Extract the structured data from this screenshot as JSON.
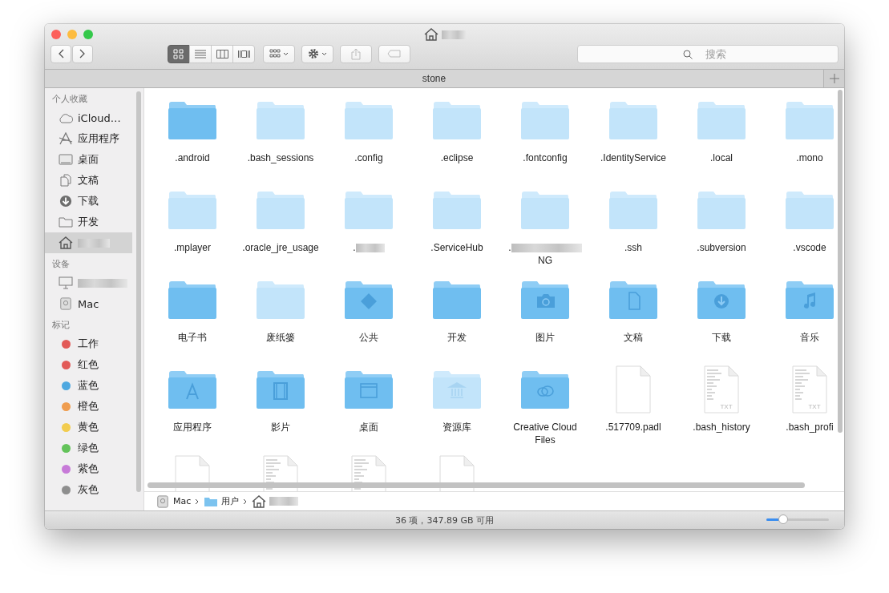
{
  "window": {
    "title_blurred": true
  },
  "toolbar": {
    "view_modes": [
      {
        "kind": "icons",
        "selected": true
      },
      {
        "kind": "list",
        "selected": false
      },
      {
        "kind": "columns",
        "selected": false
      },
      {
        "kind": "cover",
        "selected": false
      }
    ]
  },
  "search": {
    "placeholder": "搜索"
  },
  "tabs": [
    {
      "label": "stone"
    }
  ],
  "sidebar": {
    "sections": [
      {
        "title": "个人收藏",
        "items": [
          {
            "label": "iCloud…",
            "selected": false
          },
          {
            "label": "应用程序",
            "selected": false
          },
          {
            "label": "桌面",
            "selected": false
          },
          {
            "label": "文稿",
            "selected": false
          },
          {
            "label": "下载",
            "selected": false
          },
          {
            "label": "开发",
            "selected": false
          },
          {
            "blurred": true,
            "selected": true
          }
        ]
      },
      {
        "title": "设备",
        "items": [
          {
            "blurred": true,
            "selected": false
          },
          {
            "label": "Mac",
            "selected": false
          }
        ]
      },
      {
        "title": "标记",
        "items": [
          {
            "label": "工作",
            "color": "#e25a57",
            "selected": false
          },
          {
            "label": "红色",
            "color": "#e25a57",
            "selected": false
          },
          {
            "label": "蓝色",
            "color": "#4ea8e0",
            "selected": false
          },
          {
            "label": "橙色",
            "color": "#ef9d4f",
            "selected": false
          },
          {
            "label": "黄色",
            "color": "#f2cc4f",
            "selected": false
          },
          {
            "label": "绿色",
            "color": "#63c35a",
            "selected": false
          },
          {
            "label": "紫色",
            "color": "#c77ad8",
            "selected": false
          },
          {
            "label": "灰色",
            "color": "#8e8e8e",
            "selected": false
          }
        ]
      }
    ]
  },
  "items": [
    {
      "kind": "folder",
      "hidden": false,
      "label": ".android"
    },
    {
      "kind": "folder",
      "hidden": true,
      "label": ".bash_sessions"
    },
    {
      "kind": "folder",
      "hidden": true,
      "label": ".config"
    },
    {
      "kind": "folder",
      "hidden": true,
      "label": ".eclipse"
    },
    {
      "kind": "folder",
      "hidden": true,
      "label": ".fontconfig"
    },
    {
      "kind": "folder",
      "hidden": true,
      "label": ".IdentityService"
    },
    {
      "kind": "folder",
      "hidden": true,
      "label": ".local"
    },
    {
      "kind": "folder",
      "hidden": true,
      "label": ".mono"
    },
    {
      "kind": "folder",
      "hidden": true,
      "label": ".mplayer"
    },
    {
      "kind": "folder",
      "hidden": true,
      "label": ".oracle_jre_usage"
    },
    {
      "kind": "folder",
      "hidden": true,
      "label": ".",
      "blurred": true
    },
    {
      "kind": "folder",
      "hidden": true,
      "label": ".ServiceHub"
    },
    {
      "kind": "folder",
      "hidden": true,
      "label": ".",
      "blurred": true,
      "second_line": "NG"
    },
    {
      "kind": "folder",
      "hidden": true,
      "label": ".ssh"
    },
    {
      "kind": "folder",
      "hidden": true,
      "label": ".subversion"
    },
    {
      "kind": "folder",
      "hidden": true,
      "label": ".vscode"
    },
    {
      "kind": "folder",
      "hidden": false,
      "label": "电子书"
    },
    {
      "kind": "folder",
      "hidden": true,
      "label": "废纸篓"
    },
    {
      "kind": "public",
      "hidden": false,
      "label": "公共"
    },
    {
      "kind": "folder",
      "hidden": false,
      "label": "开发"
    },
    {
      "kind": "pictures",
      "hidden": false,
      "label": "图片"
    },
    {
      "kind": "documents",
      "hidden": false,
      "label": "文稿"
    },
    {
      "kind": "downloads",
      "hidden": false,
      "label": "下载"
    },
    {
      "kind": "music",
      "hidden": false,
      "label": "音乐"
    },
    {
      "kind": "applications",
      "hidden": false,
      "label": "应用程序"
    },
    {
      "kind": "movies",
      "hidden": false,
      "label": "影片"
    },
    {
      "kind": "desktop",
      "hidden": false,
      "label": "桌面"
    },
    {
      "kind": "library",
      "hidden": true,
      "label": "资源库"
    },
    {
      "kind": "cloud",
      "hidden": false,
      "label": "Creative Cloud Files"
    },
    {
      "kind": "file",
      "label": ".517709.padl"
    },
    {
      "kind": "textfile",
      "label": ".bash_history",
      "type_label": "TXT"
    },
    {
      "kind": "textfile",
      "label": ".bash_profi",
      "type_label": "TXT"
    },
    {
      "kind": "file"
    },
    {
      "kind": "textfile"
    },
    {
      "kind": "textfile"
    },
    {
      "kind": "file"
    }
  ],
  "path_bar": [
    {
      "label": "Mac"
    },
    {
      "label": "用户"
    },
    {
      "blurred": true
    }
  ],
  "status_bar": {
    "text": "36 项，347.89 GB 可用",
    "zoom": {
      "level": 0.27
    }
  }
}
